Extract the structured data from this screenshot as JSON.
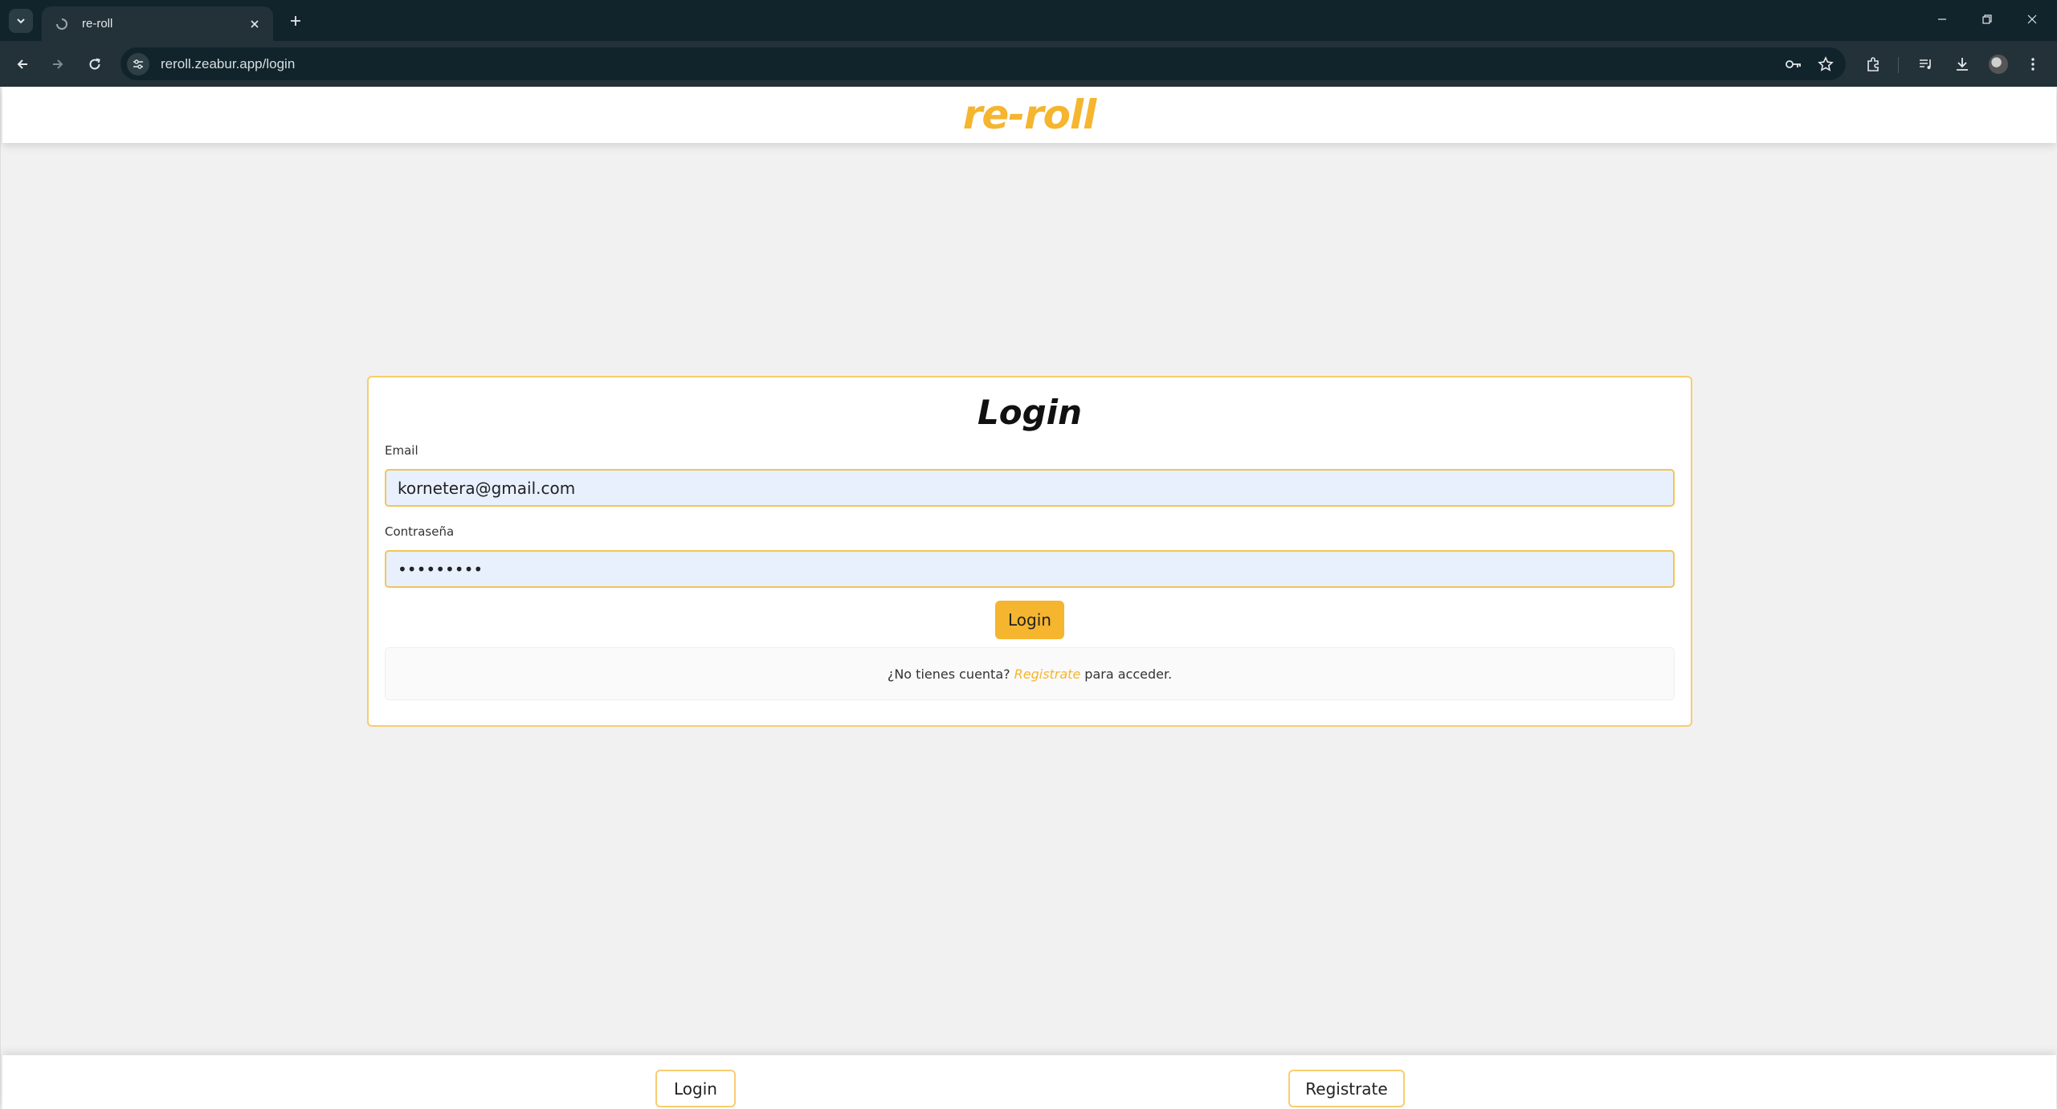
{
  "browser": {
    "tab_title": "re-roll",
    "url": "reroll.zeabur.app/login"
  },
  "app": {
    "logo": "re-roll"
  },
  "login_form": {
    "title": "Login",
    "email_label": "Email",
    "email_value": "kornetera@gmail.com",
    "password_label": "Contraseña",
    "password_value": "123456789",
    "submit_label": "Login",
    "register_prompt_prefix": "¿No tienes cuenta?",
    "register_link": "Registrate",
    "register_prompt_suffix": "para acceder."
  },
  "bottom_nav": {
    "login_label": "Login",
    "register_label": "Registrate"
  },
  "colors": {
    "accent": "#f5b52e",
    "accent_border": "#f7cd6e",
    "input_bg": "#e8f0fe",
    "page_bg": "#f2f1f1"
  }
}
